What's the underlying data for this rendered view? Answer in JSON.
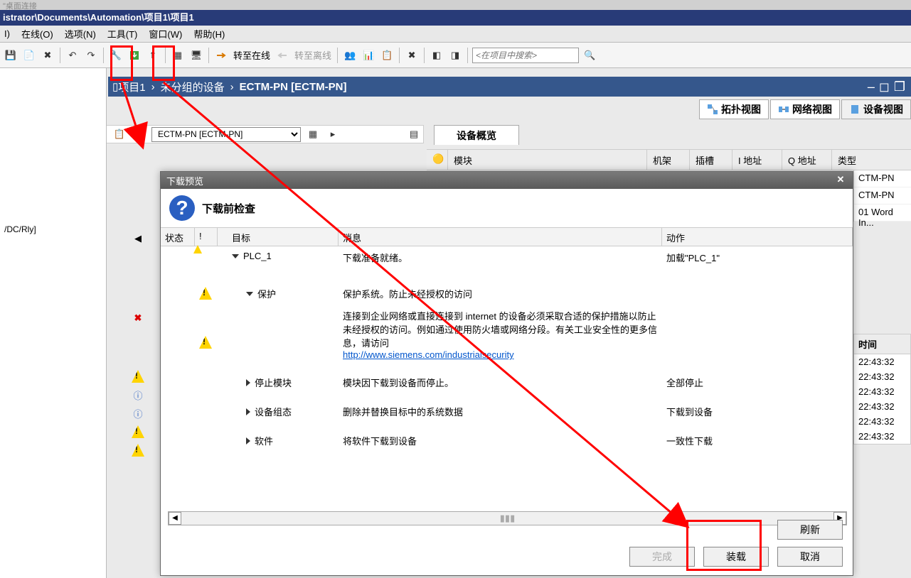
{
  "topgray": "\"桌面连接",
  "title": "istrator\\Documents\\Automation\\项目1\\项目1",
  "menu": {
    "online": "在线(O)",
    "options": "选项(N)",
    "tools": "工具(T)",
    "window": "窗口(W)",
    "help": "帮助(H)",
    "extra": "I)"
  },
  "toolbar": {
    "go_online": "转至在线",
    "go_offline": "转至离线",
    "search_ph": "<在项目中搜索>"
  },
  "breadcrumb": {
    "p1": "项目1",
    "p2": "未分组的设备",
    "p3": "ECTM-PN [ECTM-PN]"
  },
  "viewtabs": {
    "topo": "拓扑视图",
    "net": "网络视图",
    "dev": "设备视图"
  },
  "device_dropdown": "ECTM-PN [ECTM-PN]",
  "dev_overview_tab": "设备概览",
  "dev_cols": {
    "module": "模块",
    "rack": "机架",
    "slot": "插槽",
    "i_addr": "I 地址",
    "q_addr": "Q 地址",
    "type": "类型"
  },
  "dev_rows": {
    "r1": "CTM-PN",
    "r2": "CTM-PN",
    "r3": "01 Word In..."
  },
  "left": {
    "item1": "/DC/Rly]"
  },
  "time_hdr": "时间",
  "times": [
    "22:43:32",
    "22:43:32",
    "22:43:32",
    "22:43:32",
    "22:43:32",
    "22:43:32"
  ],
  "dialog": {
    "title": "下载预览",
    "subtitle": "下载前检查",
    "cols": {
      "state": "状态",
      "ex": "!",
      "target": "目标",
      "msg": "消息",
      "action": "动作"
    },
    "rows": [
      {
        "target": "PLC_1",
        "msg": "下载准备就绪。",
        "action": "加载\"PLC_1\""
      },
      {
        "target": "保护",
        "msg": "保护系统。防止未经授权的访问"
      },
      {
        "msg": "连接到企业网络或直接连接到 internet 的设备必须采取合适的保护措施以防止未经授权的访问。例如通过使用防火墙或网络分段。有关工业安全性的更多信息，请访问",
        "link": "http://www.siemens.com/industrialsecurity"
      },
      {
        "target": "停止模块",
        "msg": "模块因下载到设备而停止。",
        "action": "全部停止"
      },
      {
        "target": "设备组态",
        "msg": "删除并替换目标中的系统数据",
        "action": "下载到设备"
      },
      {
        "target": "软件",
        "msg": "将软件下载到设备",
        "action": "一致性下载"
      }
    ],
    "btn_refresh": "刷新",
    "btn_finish": "完成",
    "btn_load": "装载",
    "btn_cancel": "取消"
  }
}
